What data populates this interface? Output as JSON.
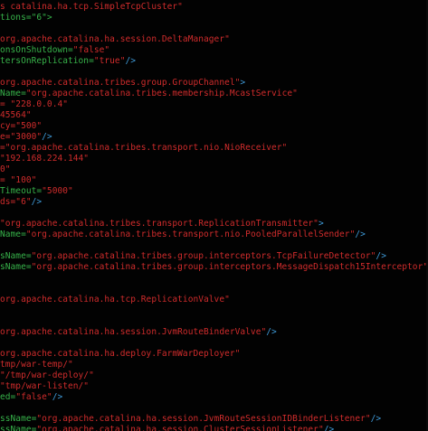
{
  "colors": {
    "background": "#020202",
    "tag": "#3f9bd9",
    "attribute": "#37b34a",
    "value": "#d02c2c",
    "punctuation": "#3f9bd9"
  },
  "lines": [
    {
      "segments": [
        {
          "t": "s catalina.ha.tcp.SimpleTcpCluster\"",
          "c": "value"
        }
      ]
    },
    {
      "segments": [
        {
          "t": "tions=\"6\">",
          "c": "attribute"
        }
      ]
    },
    {
      "segments": []
    },
    {
      "segments": [
        {
          "t": "org.apache.catalina.ha.session.DeltaManager\"",
          "c": "value"
        }
      ]
    },
    {
      "segments": [
        {
          "t": "onsOnShutdown=",
          "c": "attribute"
        },
        {
          "t": "\"false\"",
          "c": "value"
        }
      ]
    },
    {
      "segments": [
        {
          "t": "tersOnReplication=",
          "c": "attribute"
        },
        {
          "t": "\"true\"",
          "c": "value"
        },
        {
          "t": "/>",
          "c": "punctuation"
        }
      ]
    },
    {
      "segments": []
    },
    {
      "segments": [
        {
          "t": "org.apache.catalina.tribes.group.GroupChannel\"",
          "c": "value"
        },
        {
          "t": ">",
          "c": "punctuation"
        }
      ]
    },
    {
      "segments": [
        {
          "t": "Name=",
          "c": "attribute"
        },
        {
          "t": "\"org.apache.catalina.tribes.membership.McastService\"",
          "c": "value"
        }
      ]
    },
    {
      "segments": [
        {
          "t": "= \"228.0.0.4\"",
          "c": "value"
        }
      ]
    },
    {
      "segments": [
        {
          "t": "45564\"",
          "c": "value"
        }
      ]
    },
    {
      "segments": [
        {
          "t": "cy=\"500\"",
          "c": "value"
        }
      ]
    },
    {
      "segments": [
        {
          "t": "e=\"3000\"",
          "c": "value"
        },
        {
          "t": "/>",
          "c": "punctuation"
        }
      ]
    },
    {
      "segments": [
        {
          "t": "=\"org.apache.catalina.tribes.transport.nio.NioReceiver\"",
          "c": "value"
        }
      ]
    },
    {
      "segments": [
        {
          "t": "\"192.168.224.144\"",
          "c": "value"
        }
      ]
    },
    {
      "segments": [
        {
          "t": "0\"",
          "c": "value"
        }
      ]
    },
    {
      "segments": [
        {
          "t": "= \"100\"",
          "c": "value"
        }
      ]
    },
    {
      "segments": [
        {
          "t": "Timeout=",
          "c": "attribute"
        },
        {
          "t": "\"5000\"",
          "c": "value"
        }
      ]
    },
    {
      "segments": [
        {
          "t": "ds=\"6\"",
          "c": "value"
        },
        {
          "t": "/>",
          "c": "punctuation"
        }
      ]
    },
    {
      "segments": []
    },
    {
      "segments": [
        {
          "t": "\"org.apache.catalina.tribes.transport.ReplicationTransmitter\"",
          "c": "value"
        },
        {
          "t": ">",
          "c": "punctuation"
        }
      ]
    },
    {
      "segments": [
        {
          "t": "Name=",
          "c": "attribute"
        },
        {
          "t": "\"org.apache.catalina.tribes.transport.nio.PooledParallelSender\"",
          "c": "value"
        },
        {
          "t": "/>",
          "c": "punctuation"
        }
      ]
    },
    {
      "segments": []
    },
    {
      "segments": [
        {
          "t": "sName=",
          "c": "attribute"
        },
        {
          "t": "\"org.apache.catalina.tribes.group.interceptors.TcpFailureDetector\"",
          "c": "value"
        },
        {
          "t": "/>",
          "c": "punctuation"
        }
      ]
    },
    {
      "segments": [
        {
          "t": "sName=",
          "c": "attribute"
        },
        {
          "t": "\"org.apache.catalina.tribes.group.interceptors.MessageDispatch15Interceptor\"",
          "c": "value"
        }
      ]
    },
    {
      "segments": []
    },
    {
      "segments": []
    },
    {
      "segments": [
        {
          "t": "org.apache.catalina.ha.tcp.ReplicationValve\"",
          "c": "value"
        }
      ]
    },
    {
      "segments": []
    },
    {
      "segments": []
    },
    {
      "segments": [
        {
          "t": "org.apache.catalina.ha.session.JvmRouteBinderValve\"",
          "c": "value"
        },
        {
          "t": "/>",
          "c": "punctuation"
        }
      ]
    },
    {
      "segments": []
    },
    {
      "segments": [
        {
          "t": "org.apache.catalina.ha.deploy.FarmWarDeployer\"",
          "c": "value"
        }
      ]
    },
    {
      "segments": [
        {
          "t": "tmp/war-temp/\"",
          "c": "value"
        }
      ]
    },
    {
      "segments": [
        {
          "t": "\"/tmp/war-deploy/\"",
          "c": "value"
        }
      ]
    },
    {
      "segments": [
        {
          "t": "\"tmp/war-listen/\"",
          "c": "value"
        }
      ]
    },
    {
      "segments": [
        {
          "t": "ed=",
          "c": "attribute"
        },
        {
          "t": "\"false\"",
          "c": "value"
        },
        {
          "t": "/>",
          "c": "punctuation"
        }
      ]
    },
    {
      "segments": []
    },
    {
      "segments": [
        {
          "t": "ssName=",
          "c": "attribute"
        },
        {
          "t": "\"org.apache.catalina.ha.session.JvmRouteSessionIDBinderListener\"",
          "c": "value"
        },
        {
          "t": "/>",
          "c": "punctuation"
        }
      ]
    },
    {
      "segments": [
        {
          "t": "ssName=",
          "c": "attribute"
        },
        {
          "t": "\"org.apache.catalina.ha.session.ClusterSessionListener\"",
          "c": "value"
        },
        {
          "t": "/>",
          "c": "punctuation"
        }
      ]
    }
  ]
}
